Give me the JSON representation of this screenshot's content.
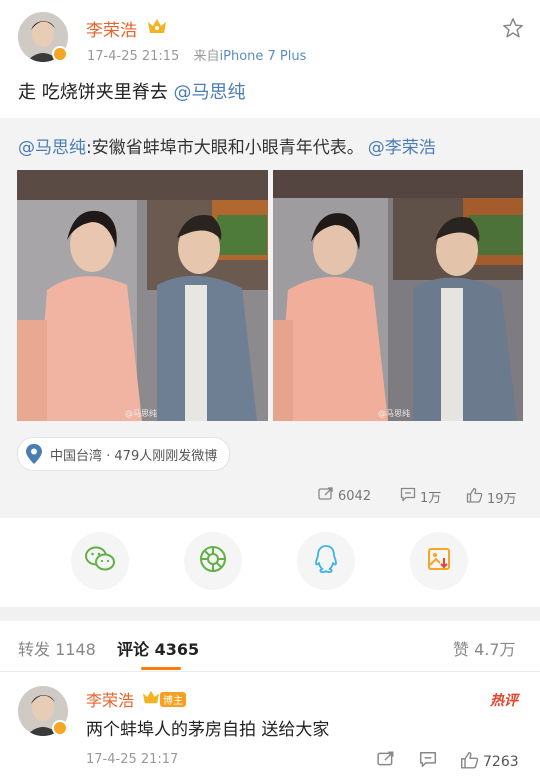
{
  "post": {
    "author": "李荣浩",
    "time": "17-4-25 21:15",
    "source_prefix": "来自",
    "source": "iPhone 7 Plus",
    "text_plain": "走 吃烧饼夹里脊去 ",
    "text_mention": "@马思纯"
  },
  "repost": {
    "mention1": "@马思纯",
    "text": ":安徽省蚌埠市大眼和小眼青年代表。",
    "mention2": "@李荣浩",
    "location": "中国台湾 · 479人刚刚发微博",
    "watermark1": "@马思纯",
    "watermark2": "@马思纯"
  },
  "stats": {
    "reposts": "6042",
    "comments": "1万",
    "likes": "19万"
  },
  "share_icons": [
    "wechat-icon",
    "moments-icon",
    "qq-icon",
    "save-image-icon"
  ],
  "tabs": {
    "repost_label": "转发",
    "repost_count": "1148",
    "comment_label": "评论",
    "comment_count": "4365",
    "like_label": "赞",
    "like_count": "4.7万"
  },
  "comment": {
    "author": "李荣浩",
    "badge": "博主",
    "hot": "热评",
    "text": "两个蚌埠人的茅房自拍 送给大家",
    "time": "17-4-25 21:17",
    "likes": "7263"
  },
  "colors": {
    "accent": "#ff7b0f",
    "name": "#e8632b",
    "link": "#4a7db4"
  }
}
